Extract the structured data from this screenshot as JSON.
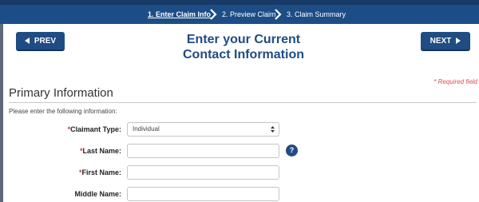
{
  "steps": [
    {
      "label": "1. Enter Claim Info",
      "active": true
    },
    {
      "label": "2. Preview Claim",
      "active": false
    },
    {
      "label": "3. Claim Summary",
      "active": false
    }
  ],
  "nav": {
    "prev_label": "PREV",
    "next_label": "NEXT"
  },
  "page": {
    "title_line1": "Enter your Current",
    "title_line2": "Contact Information",
    "required_note": "* Required field"
  },
  "section": {
    "title": "Primary Information",
    "instruction": "Please enter the following information:"
  },
  "form": {
    "required_marker": "*",
    "claimant_type": {
      "label": "Claimant Type:",
      "value": "Individual",
      "required": true
    },
    "last_name": {
      "label": "Last Name:",
      "value": "",
      "required": true
    },
    "first_name": {
      "label": "First Name:",
      "value": "",
      "required": true
    },
    "middle_name": {
      "label": "Middle Name:",
      "value": "",
      "required": false
    },
    "help_glyph": "?"
  },
  "colors": {
    "brand": "#1f4c83",
    "steps_bar": "#1d4d86",
    "required": "#d23a3a"
  }
}
